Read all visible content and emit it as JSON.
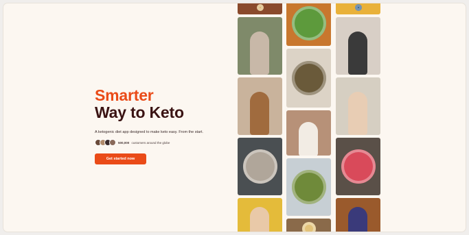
{
  "hero": {
    "headline_line1": "Smarter",
    "headline_line2": "Way to Keto",
    "tagline": "A ketogenic diet app designed to make keto easy. From the start.",
    "social_proof_count": "500,000",
    "social_proof_text": "customers around the globe",
    "cta_label": "Get started now"
  },
  "colors": {
    "accent": "#ea4b18",
    "headline_dark": "#3a1313",
    "background": "#fcf7f1"
  },
  "gallery": {
    "columns": [
      {
        "items": [
          {
            "kind": "food",
            "bg": "#8a4a2c",
            "accent": "#d9b06a"
          },
          {
            "kind": "person",
            "bg": "#7f8a6a",
            "accent": "#c8b8a8"
          },
          {
            "kind": "person",
            "bg": "#c9b39c",
            "accent": "#a06b3e"
          },
          {
            "kind": "food",
            "bg": "#4a4f52",
            "accent": "#b0a69a"
          },
          {
            "kind": "person",
            "bg": "#e4bb3a",
            "accent": "#e9c9a8"
          }
        ]
      },
      {
        "items": [
          {
            "kind": "food",
            "bg": "#c8772e",
            "accent": "#5d9a3c"
          },
          {
            "kind": "food",
            "bg": "#dcd3c6",
            "accent": "#6a5a3a"
          },
          {
            "kind": "person",
            "bg": "#b79178",
            "accent": "#f2ece4"
          },
          {
            "kind": "food",
            "bg": "#c7cfd4",
            "accent": "#6f8a3a"
          },
          {
            "kind": "food",
            "bg": "#8a6a4a",
            "accent": "#e2c27a"
          }
        ]
      },
      {
        "items": [
          {
            "kind": "food",
            "bg": "#e9b13a",
            "accent": "#2d5b8a"
          },
          {
            "kind": "person",
            "bg": "#d8cfc6",
            "accent": "#3a3a3a"
          },
          {
            "kind": "person",
            "bg": "#d6cfc2",
            "accent": "#e8cdb4"
          },
          {
            "kind": "food",
            "bg": "#5a5048",
            "accent": "#d94a5a"
          },
          {
            "kind": "person",
            "bg": "#9a5a2c",
            "accent": "#3a3a7a"
          }
        ]
      }
    ]
  }
}
